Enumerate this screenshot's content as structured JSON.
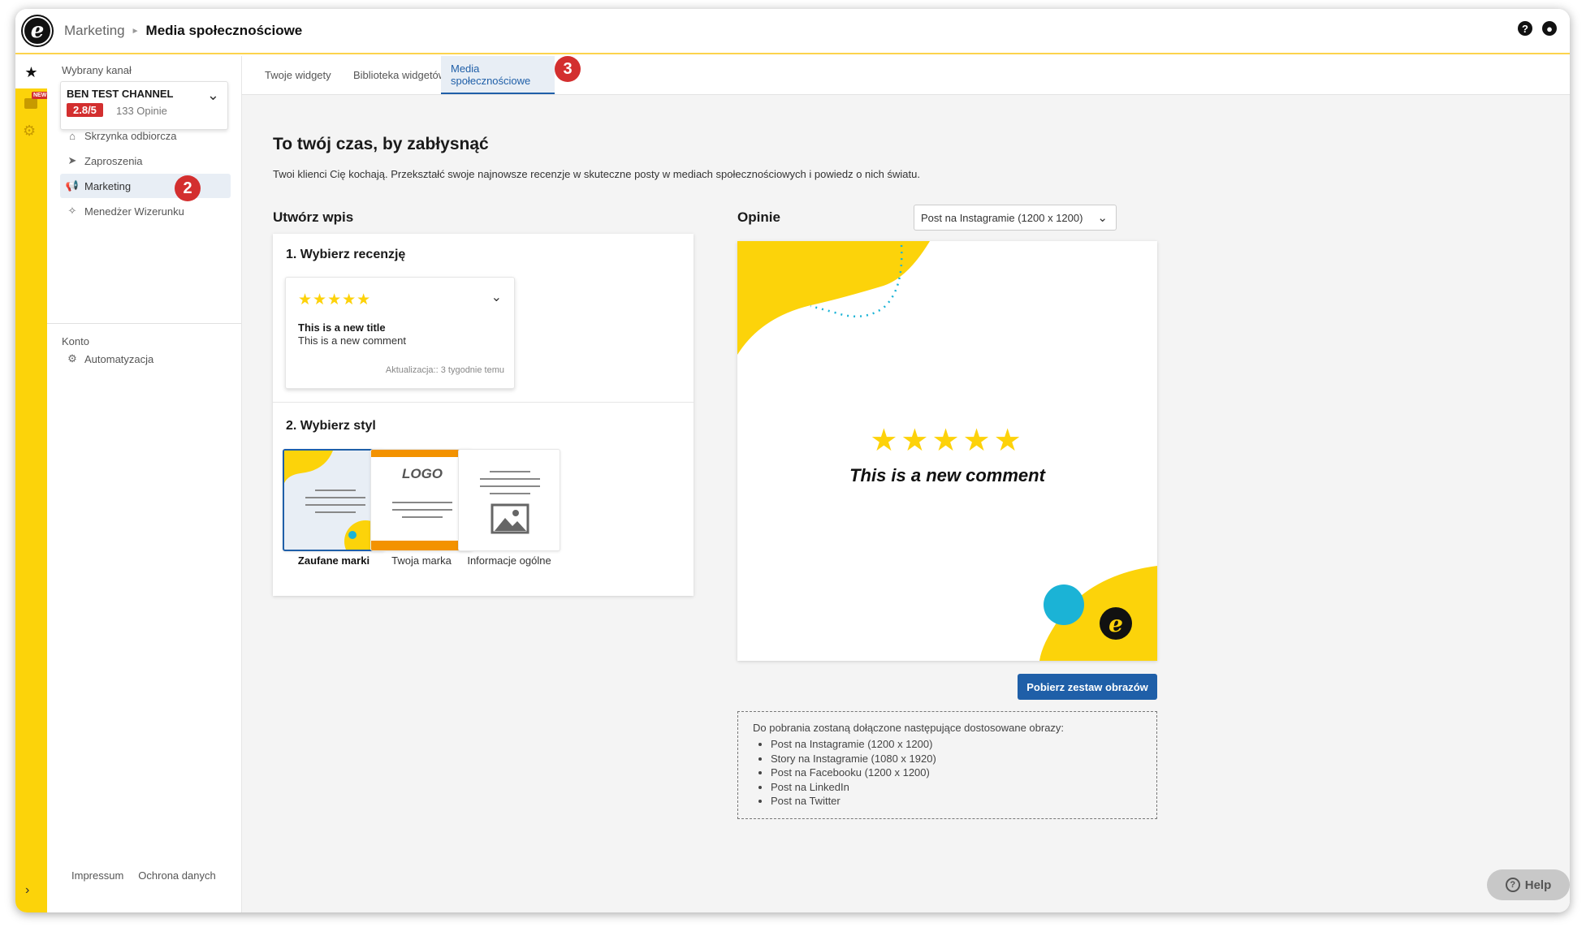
{
  "header": {
    "section": "Marketing",
    "page": "Media społecznościowe",
    "help_icon": "?",
    "user_icon": "user"
  },
  "rail": {
    "new_badge": "NEW"
  },
  "sidebar": {
    "channel_label": "Wybrany kanał",
    "channel_name": "BEN TEST CHANNEL",
    "rating": "2.8/5",
    "reviews_count": "133 Opinie",
    "items": [
      {
        "label": "Skrzynka odbiorcza",
        "icon": "inbox-icon"
      },
      {
        "label": "Zaproszenia",
        "icon": "send-icon"
      },
      {
        "label": "Marketing",
        "icon": "megaphone-icon"
      },
      {
        "label": "Menedżer Wizerunku",
        "icon": "sparkle-icon"
      }
    ],
    "account_label": "Konto",
    "account_items": [
      {
        "label": "Automatyzacja",
        "icon": "robot-icon"
      }
    ],
    "footer": {
      "impressum": "Impressum",
      "privacy": "Ochrona danych"
    }
  },
  "badges": {
    "marketing": "2",
    "social_tab": "3"
  },
  "tabs": [
    {
      "label": "Twoje widgety",
      "active": false
    },
    {
      "label": "Biblioteka widgetów",
      "active": false
    },
    {
      "label": "Media społecznościowe",
      "active": true
    }
  ],
  "main": {
    "heading": "To twój czas, by zabłysnąć",
    "intro": "Twoi klienci Cię kochają. Przekształć swoje najnowsze recenzje w skuteczne posty w mediach społecznościowych i powiedz o nich światu.",
    "create_label": "Utwórz wpis",
    "step1": "1. Wybierz recenzję",
    "review": {
      "stars": "★★★★★",
      "title": "This is a new title",
      "comment": "This is a new comment",
      "updated": "Aktualizacja:: 3 tygodnie temu"
    },
    "step2": "2. Wybierz styl",
    "styles": [
      {
        "label": "Zaufane marki",
        "selected": true
      },
      {
        "label": "Twoja marka",
        "selected": false,
        "logo_text": "LOGO"
      },
      {
        "label": "Informacje ogólne",
        "selected": false
      }
    ],
    "opinions_label": "Opinie",
    "format_select": "Post na Instagramie (1200 x 1200)",
    "preview": {
      "stars": "★★★★★",
      "text": "This is a new comment",
      "logo": "e"
    },
    "download_button": "Pobierz zestaw obrazów",
    "info_intro": "Do pobrania zostaną dołączone następujące dostosowane obrazy:",
    "info_items": [
      "Post na Instagramie (1200 x 1200)",
      "Story na Instagramie (1080 x 1920)",
      "Post na Facebooku (1200 x 1200)",
      "Post na LinkedIn",
      "Post na Twitter"
    ],
    "help_button": "Help"
  },
  "colors": {
    "accent_yellow": "#fcd30a",
    "brand_blue": "#1f5fa8",
    "badge_red": "#d32f2f",
    "cyan": "#1bb3d6"
  }
}
